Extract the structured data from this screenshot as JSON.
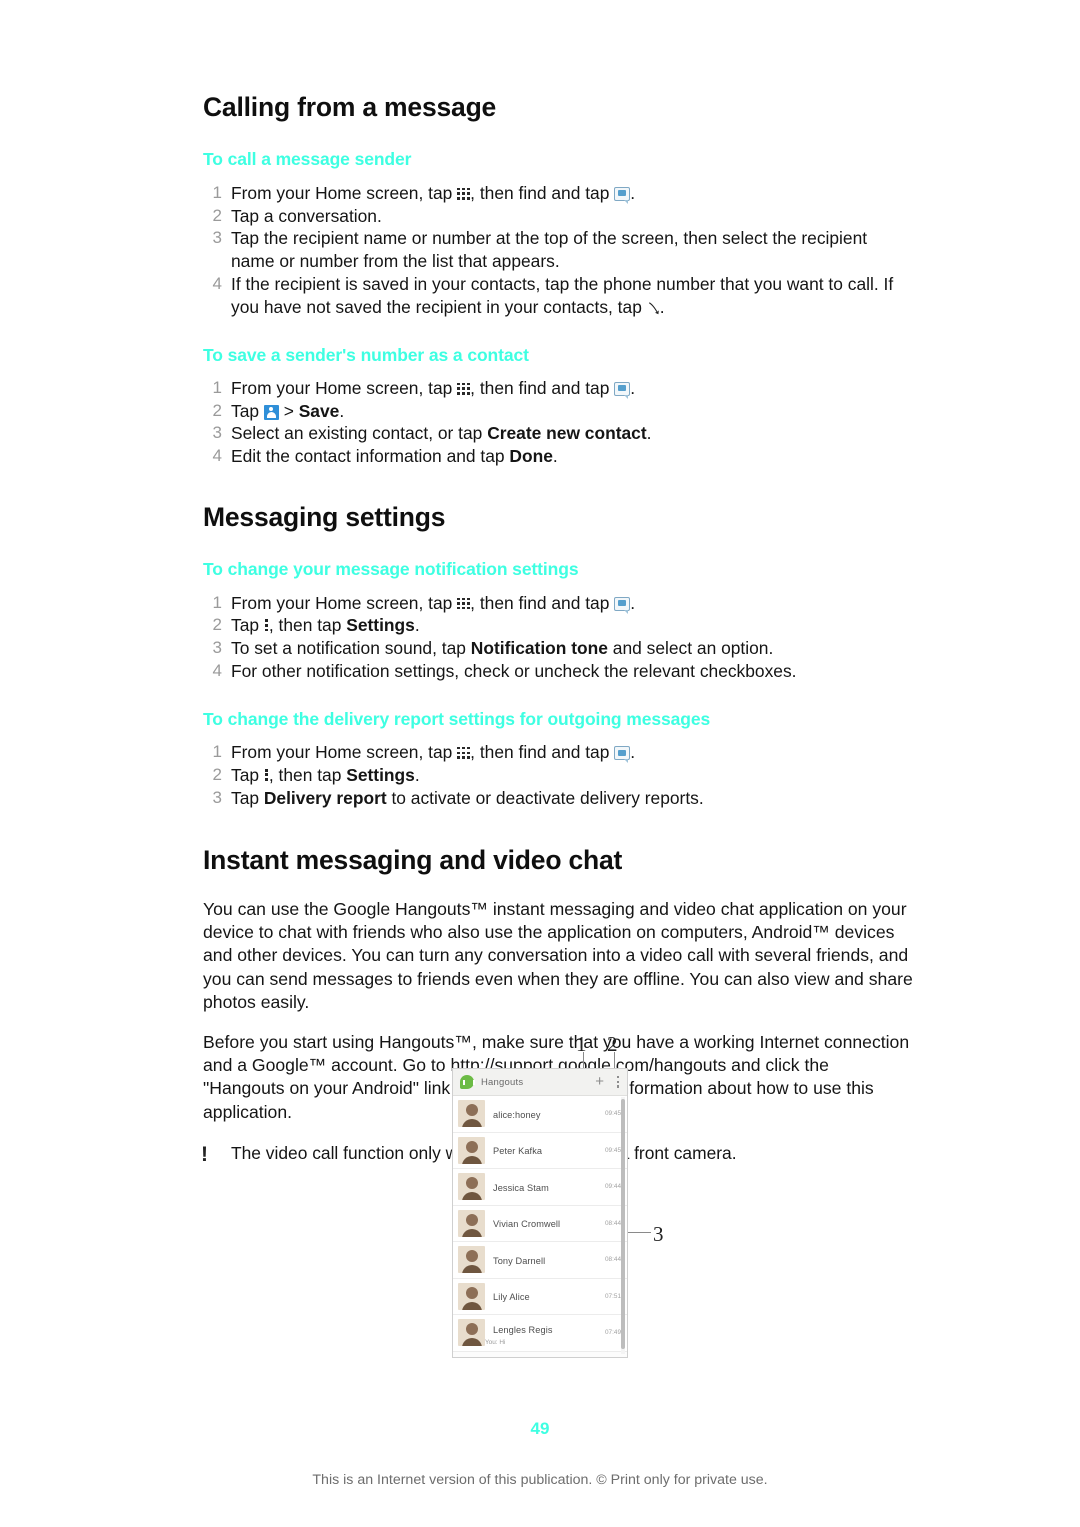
{
  "document": {
    "page_number": "49",
    "footer": "This is an Internet version of this publication. © Print only for private use."
  },
  "sections": [
    {
      "title": "Calling from a message",
      "procedures": [
        {
          "heading": "To call a message sender",
          "steps": [
            "From your Home screen, tap [appdrawer-icon], then find and tap [message-icon].",
            "Tap a conversation.",
            "Tap the recipient name or number at the top of the screen, then select the recipient name or number from the list that appears.",
            "If the recipient is saved in your contacts, tap the phone number that you want to call. If you have not saved the recipient in your contacts, tap [phone-icon]."
          ]
        },
        {
          "heading": "To save a sender's number as a contact",
          "steps": [
            "From your Home screen, tap [appdrawer-icon], then find and tap [message-icon].",
            "Tap [contact-icon] > Save.",
            "Select an existing contact, or tap Create new contact.",
            "Edit the contact information and tap Done."
          ]
        }
      ]
    },
    {
      "title": "Messaging settings",
      "procedures": [
        {
          "heading": "To change your message notification settings",
          "steps": [
            "From your Home screen, tap [appdrawer-icon], then find and tap [message-icon].",
            "Tap [overflow-icon], then tap Settings.",
            "To set a notification sound, tap Notification tone and select an option.",
            "For other notification settings, check or uncheck the relevant checkboxes."
          ]
        },
        {
          "heading": "To change the delivery report settings for outgoing messages",
          "steps": [
            "From your Home screen, tap [appdrawer-icon], then find and tap [message-icon].",
            "Tap [overflow-icon], then tap Settings.",
            "Tap Delivery report to activate or deactivate delivery reports."
          ]
        }
      ]
    },
    {
      "title": "Instant messaging and video chat",
      "paragraphs": [
        "You can use the Google Hangouts™ instant messaging and video chat application on your device to chat with friends who also use the application on computers, Android™ devices and other devices. You can turn any conversation into a video call with several friends, and you can send messages to friends even when they are offline. You can also view and share photos easily.",
        "Before you start using Hangouts™, make sure that you have a working Internet connection and a Google™ account. Go to http://support.google.com/hangouts and click the \"Hangouts on your Android\" link to get more detailed information about how to use this application."
      ],
      "note": "The video call function only works on devices with a front camera."
    }
  ],
  "figure": {
    "callouts": [
      "1",
      "2",
      "3"
    ],
    "screenshot": {
      "app_title": "Hangouts",
      "add_button": "+",
      "conversations": [
        {
          "name": "alice:honey",
          "time": "09:45",
          "sub": ""
        },
        {
          "name": "Peter Kafka",
          "time": "09:45",
          "sub": ""
        },
        {
          "name": "Jessica Stam",
          "time": "09:44",
          "sub": ""
        },
        {
          "name": "Vivian Cromwell",
          "time": "08:44",
          "sub": ""
        },
        {
          "name": "Tony Darnell",
          "time": "08:44",
          "sub": ""
        },
        {
          "name": "Lily Alice",
          "time": "07:51",
          "sub": ""
        },
        {
          "name": "Lengles Regis",
          "time": "07:49",
          "sub": "You: Hi"
        }
      ]
    }
  },
  "colors": {
    "accent_cyan": "#3EFFE2",
    "step_number_gray": "#9a9a9a",
    "footer_gray": "#6d6d6d"
  }
}
